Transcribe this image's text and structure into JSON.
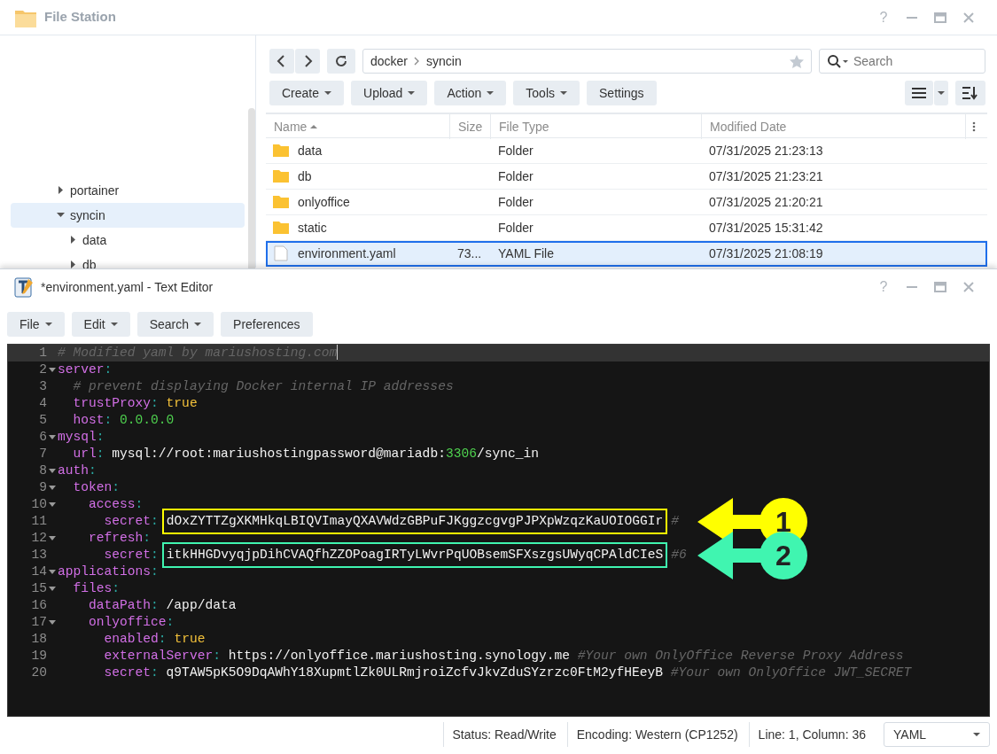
{
  "file_station": {
    "title": "File Station",
    "help": "?",
    "tree": [
      {
        "label": "portainer",
        "expanded": false,
        "selected": false
      },
      {
        "label": "syncin",
        "expanded": true,
        "selected": true,
        "children": [
          {
            "label": "data",
            "expanded": false,
            "selected": false
          },
          {
            "label": "db",
            "expanded": false,
            "selected": false
          }
        ]
      }
    ],
    "path": [
      "docker",
      "syncin"
    ],
    "search": {
      "placeholder": "Search"
    },
    "toolbar": [
      {
        "label": "Create",
        "dropdown": true
      },
      {
        "label": "Upload",
        "dropdown": true
      },
      {
        "label": "Action",
        "dropdown": true
      },
      {
        "label": "Tools",
        "dropdown": true
      },
      {
        "label": "Settings",
        "dropdown": false
      }
    ],
    "table": {
      "columns": [
        {
          "label": "Name",
          "sorted": true
        },
        {
          "label": "Size",
          "sorted": false
        },
        {
          "label": "File Type",
          "sorted": false
        },
        {
          "label": "Modified Date",
          "sorted": false
        }
      ],
      "rows": [
        {
          "kind": "folder",
          "name": "data",
          "type": "Folder",
          "modified": "07/31/2025 21:23:13",
          "selected": false
        },
        {
          "kind": "folder",
          "name": "db",
          "type": "Folder",
          "modified": "07/31/2025 21:23:21",
          "selected": false
        },
        {
          "kind": "folder",
          "name": "onlyoffice",
          "type": "Folder",
          "modified": "07/31/2025 21:20:21",
          "selected": false
        },
        {
          "kind": "folder",
          "name": "static",
          "type": "Folder",
          "modified": "07/31/2025 15:31:42",
          "selected": false
        },
        {
          "kind": "file",
          "name": "environment.yaml",
          "size": "73...",
          "type": "YAML File",
          "modified": "07/31/2025 21:08:19",
          "selected": true
        }
      ]
    }
  },
  "text_editor": {
    "title": "*environment.yaml - Text Editor",
    "help": "?",
    "menus": [
      {
        "label": "File",
        "dropdown": true
      },
      {
        "label": "Edit",
        "dropdown": true
      },
      {
        "label": "Search",
        "dropdown": true
      },
      {
        "label": "Preferences",
        "dropdown": false
      }
    ],
    "lines": [
      {
        "number": "1",
        "foldable": false,
        "current": true,
        "tokens": [
          {
            "kind": "comment",
            "text": "# Modified yaml by mariushosting.com"
          }
        ]
      },
      {
        "number": "2",
        "foldable": true,
        "current": false,
        "tokens": [
          {
            "kind": "key",
            "text": "server"
          },
          {
            "kind": "punct",
            "text": ":"
          }
        ]
      },
      {
        "number": "3",
        "foldable": false,
        "current": false,
        "tokens": [
          {
            "kind": "comment",
            "text": "  # prevent displaying Docker internal IP addresses"
          }
        ]
      },
      {
        "number": "4",
        "foldable": false,
        "current": false,
        "tokens": [
          {
            "kind": "key",
            "text": "  trustProxy"
          },
          {
            "kind": "punct",
            "text": ": "
          },
          {
            "kind": "bool",
            "text": "true"
          }
        ]
      },
      {
        "number": "5",
        "foldable": false,
        "current": false,
        "tokens": [
          {
            "kind": "key",
            "text": "  host"
          },
          {
            "kind": "punct",
            "text": ": "
          },
          {
            "kind": "number",
            "text": "0.0.0.0"
          }
        ]
      },
      {
        "number": "6",
        "foldable": true,
        "current": false,
        "tokens": [
          {
            "kind": "key",
            "text": "mysql"
          },
          {
            "kind": "punct",
            "text": ":"
          }
        ]
      },
      {
        "number": "7",
        "foldable": false,
        "current": false,
        "tokens": [
          {
            "kind": "key",
            "text": "  url"
          },
          {
            "kind": "punct",
            "text": ": "
          },
          {
            "kind": "plain",
            "text": "mysql://root:mariushostingpassword@mariadb:"
          },
          {
            "kind": "number",
            "text": "3306"
          },
          {
            "kind": "plain",
            "text": "/sync_in"
          }
        ]
      },
      {
        "number": "8",
        "foldable": true,
        "current": false,
        "tokens": [
          {
            "kind": "key",
            "text": "auth"
          },
          {
            "kind": "punct",
            "text": ":"
          }
        ]
      },
      {
        "number": "9",
        "foldable": true,
        "current": false,
        "tokens": [
          {
            "kind": "key",
            "text": "  token"
          },
          {
            "kind": "punct",
            "text": ":"
          }
        ]
      },
      {
        "number": "10",
        "foldable": true,
        "current": false,
        "tokens": [
          {
            "kind": "key",
            "text": "    access"
          },
          {
            "kind": "punct",
            "text": ":"
          }
        ]
      },
      {
        "number": "11",
        "foldable": false,
        "current": false,
        "callout": {
          "label": "1",
          "color": "#ffff00"
        },
        "tokens": [
          {
            "kind": "key",
            "text": "      secret"
          },
          {
            "kind": "punct",
            "text": ":"
          },
          {
            "kind": "boxed",
            "text": "dOxZYTTZgXKMHkqLBIQVImayQXAVWdzGBPuFJKggzcgvgPJPXpWzqzKaUOIOGGIr",
            "color": "#ffff00"
          },
          {
            "kind": "comment",
            "text": "#"
          }
        ]
      },
      {
        "number": "12",
        "foldable": true,
        "current": false,
        "tokens": [
          {
            "kind": "key",
            "text": "    refresh"
          },
          {
            "kind": "punct",
            "text": ":"
          }
        ]
      },
      {
        "number": "13",
        "foldable": false,
        "current": false,
        "callout": {
          "label": "2",
          "color": "#40f5b0"
        },
        "tokens": [
          {
            "kind": "key",
            "text": "      secret"
          },
          {
            "kind": "punct",
            "text": ":"
          },
          {
            "kind": "boxed",
            "text": "itkHHGDvyqjpDihCVAQfhZZOPoagIRTyLWvrPqUOBsemSFXszgsUWyqCPAldCIeS",
            "color": "#40f5b0"
          },
          {
            "kind": "comment",
            "text": "#6"
          }
        ]
      },
      {
        "number": "14",
        "foldable": true,
        "current": false,
        "tokens": [
          {
            "kind": "key",
            "text": "applications"
          },
          {
            "kind": "punct",
            "text": ":"
          }
        ]
      },
      {
        "number": "15",
        "foldable": true,
        "current": false,
        "tokens": [
          {
            "kind": "key",
            "text": "  files"
          },
          {
            "kind": "punct",
            "text": ":"
          }
        ]
      },
      {
        "number": "16",
        "foldable": false,
        "current": false,
        "tokens": [
          {
            "kind": "key",
            "text": "    dataPath"
          },
          {
            "kind": "punct",
            "text": ": "
          },
          {
            "kind": "plain",
            "text": "/app/data"
          }
        ]
      },
      {
        "number": "17",
        "foldable": true,
        "current": false,
        "tokens": [
          {
            "kind": "key",
            "text": "    onlyoffice"
          },
          {
            "kind": "punct",
            "text": ":"
          }
        ]
      },
      {
        "number": "18",
        "foldable": false,
        "current": false,
        "tokens": [
          {
            "kind": "key",
            "text": "      enabled"
          },
          {
            "kind": "punct",
            "text": ": "
          },
          {
            "kind": "bool",
            "text": "true"
          }
        ]
      },
      {
        "number": "19",
        "foldable": false,
        "current": false,
        "tokens": [
          {
            "kind": "key",
            "text": "      externalServer"
          },
          {
            "kind": "punct",
            "text": ": "
          },
          {
            "kind": "plain",
            "text": "https://onlyoffice.mariushosting.synology.me "
          },
          {
            "kind": "comment",
            "text": "#Your own OnlyOffice Reverse Proxy Address"
          }
        ]
      },
      {
        "number": "20",
        "foldable": false,
        "current": false,
        "tokens": [
          {
            "kind": "key",
            "text": "      secret"
          },
          {
            "kind": "punct",
            "text": ": "
          },
          {
            "kind": "plain",
            "text": "q9TAW5pK5O9DqAWhY18XupmtlZk0ULRmjroiZcfvJkvZduSYzrzc0FtM2yfHEeyB "
          },
          {
            "kind": "comment",
            "text": "#Your own OnlyOffice JWT_SECRET"
          }
        ]
      }
    ],
    "status": [
      "Status: Read/Write",
      "Encoding: Western (CP1252)",
      "Line: 1, Column: 36"
    ],
    "syntax": "YAML"
  }
}
